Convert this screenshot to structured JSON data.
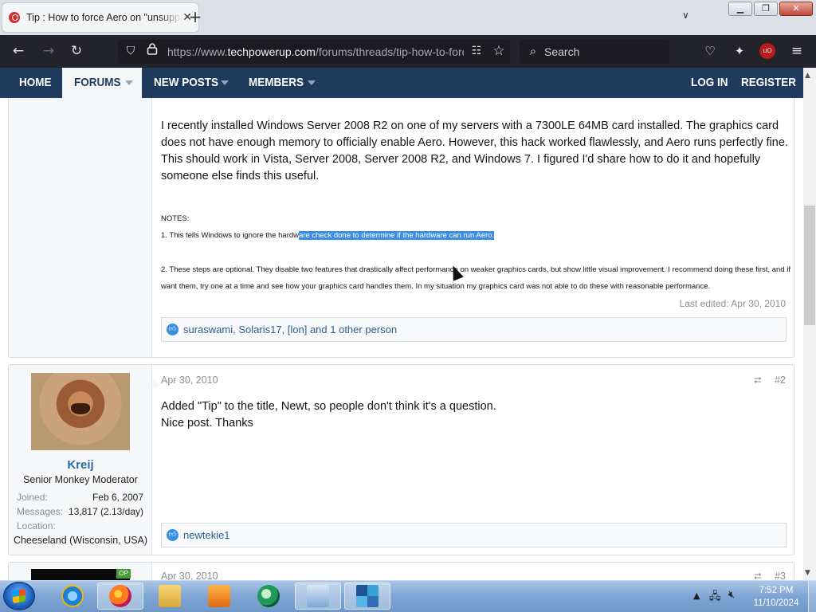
{
  "browser": {
    "tab_title": "Tip : How to force Aero on \"unsupported\" hardware",
    "tab_close": "✕",
    "new_tab": "+",
    "url_prefix": "https://www.",
    "url_host": "techpowerup.com",
    "url_path": "/forums/threads/tip-how-to-force-aero",
    "search_placeholder": "Search",
    "min": "▁",
    "max": "❐",
    "close": "✕"
  },
  "sitenav": {
    "home": "HOME",
    "forums": "FORUMS",
    "new_posts": "NEW POSTS",
    "members": "MEMBERS",
    "log_in": "LOG IN",
    "register": "REGISTER"
  },
  "post1": {
    "paragraph": "I recently installed Windows Server 2008 R2 on one of my servers with a 7300LE 64MB card installed. The graphics card does not have enough memory to officially enable Aero. However, this hack worked flawlessly, and Aero runs perfectly fine. This should work in Vista, Server 2008, Server 2008 R2, and Windows 7. I figured I'd share how to do it and hopefully someone else finds this useful.",
    "notes_heading": "NOTES:",
    "note1_plain": "1. This tells Windows to ignore the hardw",
    "note1_selected": "are check done to determine if the hardware can run Aero.",
    "note2_part1": "2. These steps are optional. They disable two features that drastically affect performance on weaker graphics cards, but show little visual improvement. I recommend doing these first, and if you feel you",
    "note2_part2": "want them, try one at a time and see how your graphics card handles them. In my situation my graphics card was not able to do these with reasonable performance.",
    "last_edited": "Last edited: Apr 30, 2010",
    "reactions": "suraswami, Solaris17, [lon] and 1 other person"
  },
  "post2": {
    "date": "Apr 30, 2010",
    "number": "#2",
    "line1": "Added \"Tip\" to the title, Newt, so people don't think it's a question.",
    "line2": "Nice post. Thanks",
    "username": "Kreij",
    "user_title": "Senior Monkey Moderator",
    "joined_label": "Joined:",
    "joined_value": "Feb 6, 2007",
    "messages_label": "Messages:",
    "messages_value": "13,817 (2.13/day)",
    "location_label": "Location:",
    "location_value": "Cheeseland (Wisconsin, USA)",
    "reactions": "newtekie1"
  },
  "post3": {
    "date": "Apr 30, 2010",
    "number": "#3",
    "op_badge": "OP"
  },
  "taskbar": {
    "time": "7:52 PM",
    "date": "11/10/2024"
  }
}
